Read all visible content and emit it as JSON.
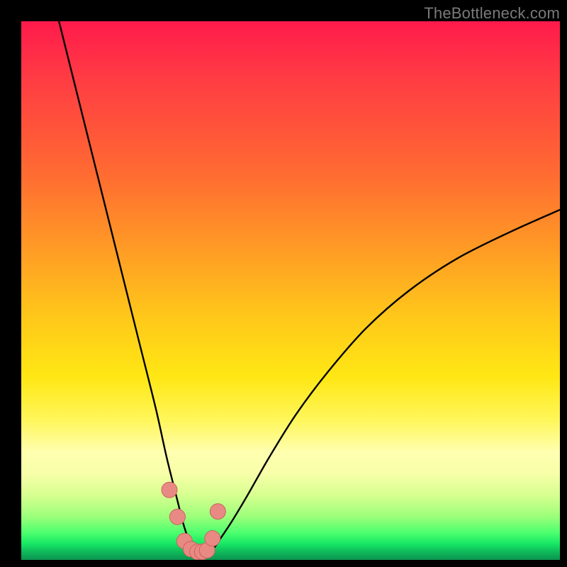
{
  "watermark": "TheBottleneck.com",
  "colors": {
    "frame": "#000000",
    "curve": "#000000",
    "marker_fill": "#e98984",
    "marker_stroke": "#c9635e",
    "gradient_top": "#ff1a4b",
    "gradient_bottom": "#0b9450"
  },
  "chart_data": {
    "type": "line",
    "title": "",
    "xlabel": "",
    "ylabel": "",
    "xlim": [
      0,
      100
    ],
    "ylim": [
      0,
      100
    ],
    "note": "V-shaped bottleneck curve; y is high (red) at the x extremes and near zero (green) at the optimum around x≈33. Background gradient maps y value to color: top=red (high bottleneck), bottom=green (low/no bottleneck). Explicit axis ticks are not drawn in source image; values are estimated from pixel position.",
    "series": [
      {
        "name": "bottleneck-curve",
        "x": [
          7,
          10,
          13,
          16,
          19,
          22,
          25,
          27,
          29,
          30,
          31,
          32,
          33,
          34,
          35,
          36,
          37,
          39,
          42,
          46,
          51,
          57,
          64,
          72,
          81,
          91,
          100
        ],
        "y": [
          100,
          88,
          76,
          64,
          52,
          40,
          28,
          19,
          11,
          7,
          4,
          2,
          1,
          1,
          1.5,
          2.5,
          4,
          7,
          12,
          19,
          27,
          35,
          43,
          50,
          56,
          61,
          65
        ]
      }
    ],
    "markers": {
      "name": "highlight-region",
      "note": "Pink rounded markers near the valley floor, roughly x≈28–36",
      "x": [
        27.5,
        29.0,
        30.3,
        31.5,
        32.7,
        33.6,
        34.5,
        35.5,
        36.5
      ],
      "y": [
        13,
        8,
        3.5,
        2,
        1.5,
        1.5,
        1.8,
        4,
        9
      ]
    }
  }
}
